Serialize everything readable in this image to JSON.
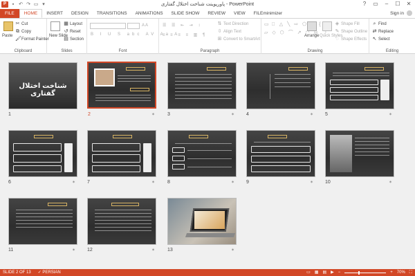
{
  "window": {
    "title": "پاورپوینت شناخت اختلال گفتاری - PowerPoint",
    "app_icon": "P",
    "controls": [
      "?",
      "▭",
      "–",
      "☐",
      "✕"
    ]
  },
  "tabs": [
    "FILE",
    "HOME",
    "INSERT",
    "DESIGN",
    "TRANSITIONS",
    "ANIMATIONS",
    "SLIDE SHOW",
    "REVIEW",
    "VIEW",
    "FILEminimizer"
  ],
  "active_tab": "HOME",
  "signin": "Sign in",
  "ribbon": {
    "clipboard": {
      "label": "Clipboard",
      "paste": "Paste",
      "cut": "Cut",
      "copy": "Copy",
      "format_painter": "Format Painter"
    },
    "slides": {
      "label": "Slides",
      "new_slide": "New Slide",
      "layout": "Layout",
      "reset": "Reset",
      "section": "Section"
    },
    "font": {
      "label": "Font"
    },
    "paragraph": {
      "label": "Paragraph",
      "text_direction": "Text Direction",
      "align_text": "Align Text",
      "convert": "Convert to SmartArt"
    },
    "drawing": {
      "label": "Drawing",
      "arrange": "Arrange",
      "quick_styles": "Quick Styles",
      "shape_fill": "Shape Fill",
      "shape_outline": "Shape Outline",
      "shape_effects": "Shape Effects"
    },
    "editing": {
      "label": "Editing",
      "find": "Find",
      "replace": "Replace",
      "select": "Select"
    }
  },
  "slides": [
    {
      "num": "1",
      "title": "شناخت اختلال گفتاری"
    },
    {
      "num": "2"
    },
    {
      "num": "3"
    },
    {
      "num": "4"
    },
    {
      "num": "5"
    },
    {
      "num": "6"
    },
    {
      "num": "7"
    },
    {
      "num": "8"
    },
    {
      "num": "9"
    },
    {
      "num": "10"
    },
    {
      "num": "11"
    },
    {
      "num": "12"
    },
    {
      "num": "13"
    }
  ],
  "selected_slide": "2",
  "status": {
    "slide": "SLIDE 2 OF 13",
    "language": "PERSIAN",
    "zoom": "70%",
    "zoom_level_pct": 70
  },
  "colors": {
    "accent": "#d24726"
  }
}
